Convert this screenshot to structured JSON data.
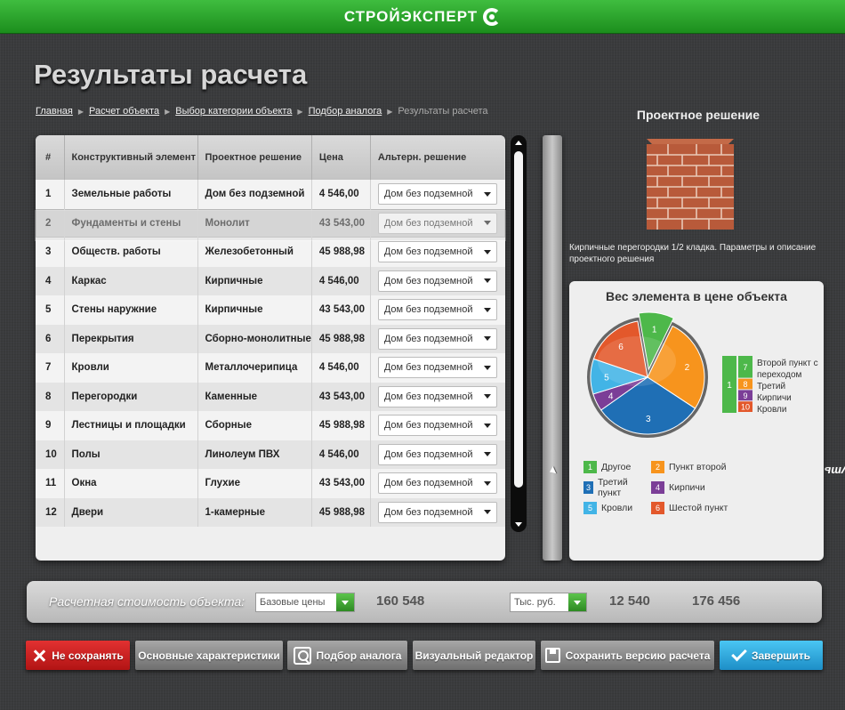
{
  "brand": {
    "name": "СТРОЙЭКСПЕРТ"
  },
  "page": {
    "title": "Результаты расчета"
  },
  "breadcrumbs": [
    "Главная",
    "Расчет объекта",
    "Выбор категории объекта",
    "Подбор аналога"
  ],
  "breadcrumb_current": "Результаты расчета",
  "table": {
    "headers": {
      "num": "#",
      "element": "Конструктивный элемент",
      "project": "Проектное решение",
      "price": "Цена",
      "alt": "Альтерн. решение"
    },
    "rows": [
      {
        "num": "1",
        "element": "Земельные работы",
        "project": "Дом без подземной",
        "price": "4 546,00",
        "alt": "Дом без подземной"
      },
      {
        "num": "2",
        "element": "Фундаменты и стены",
        "project": "Монолит",
        "price": "43 543,00",
        "alt": "Дом без подземной"
      },
      {
        "num": "3",
        "element": "Обществ. работы",
        "project": "Железобетонный",
        "price": "45 988,98",
        "alt": "Дом без подземной"
      },
      {
        "num": "4",
        "element": "Каркас",
        "project": "Кирпичные",
        "price": "4 546,00",
        "alt": "Дом без подземной"
      },
      {
        "num": "5",
        "element": "Стены наружние",
        "project": "Кирпичные",
        "price": "43 543,00",
        "alt": "Дом без подземной"
      },
      {
        "num": "6",
        "element": "Перекрытия",
        "project": "Сборно-монолитные",
        "price": "45 988,98",
        "alt": "Дом без подземной"
      },
      {
        "num": "7",
        "element": "Кровли",
        "project": "Металлочерипица",
        "price": "4 546,00",
        "alt": "Дом без подземной"
      },
      {
        "num": "8",
        "element": "Перегородки",
        "project": "Каменные",
        "price": "43 543,00",
        "alt": "Дом без подземной"
      },
      {
        "num": "9",
        "element": "Лестницы и площадки",
        "project": "Сборные",
        "price": "45 988,98",
        "alt": "Дом без подземной"
      },
      {
        "num": "10",
        "element": "Полы",
        "project": "Линолеум ПВХ",
        "price": "4 546,00",
        "alt": "Дом без подземной"
      },
      {
        "num": "11",
        "element": "Окна",
        "project": "Глухие",
        "price": "43 543,00",
        "alt": "Дом без подземной"
      },
      {
        "num": "12",
        "element": "Двери",
        "project": "1-камерные",
        "price": "45 988,98",
        "alt": "Дом без подземной"
      }
    ]
  },
  "collapse": {
    "label": "Свернуть"
  },
  "project_solution": {
    "title": "Проектное решение",
    "description": "Кирпичные перегородки 1/2 кладка. Параметры и описание проектного решения"
  },
  "chart_data": {
    "type": "pie",
    "title": "Вес элемента в цене объекта",
    "slices": [
      {
        "label": "1",
        "name": "Другое",
        "value": 10,
        "color": "#4db84a",
        "exploded": true
      },
      {
        "label": "2",
        "name": "Пункт второй",
        "value": 27,
        "color": "#f7941d"
      },
      {
        "label": "3",
        "name": "Третий пункт",
        "value": 31,
        "color": "#1f6fb5"
      },
      {
        "label": "4",
        "name": "Кирпичи",
        "value": 5,
        "color": "#7b3e97"
      },
      {
        "label": "5",
        "name": "Кровли",
        "value": 10,
        "color": "#42b4e6"
      },
      {
        "label": "6",
        "name": "Шестой пункт",
        "value": 17,
        "color": "#e3582b"
      }
    ],
    "sub_breakdown": [
      {
        "label": "7",
        "name": "Второй пункт с переходом",
        "value": 40,
        "color": "#4db84a"
      },
      {
        "label": "8",
        "name": "Третий",
        "value": 20,
        "color": "#f7941d"
      },
      {
        "label": "9",
        "name": "Кирпичи",
        "value": 20,
        "color": "#7b3e97"
      },
      {
        "label": "10",
        "name": "Кровли",
        "value": 20,
        "color": "#e3582b"
      }
    ],
    "sub_parent_label": "1",
    "legend_position": "bottom"
  },
  "summary": {
    "label": "Расчетная стоимость объекта:",
    "price_type": "Базовые цены",
    "value1": "160 548",
    "unit": "Тыс. руб.",
    "value2": "12 540",
    "value3": "176 456"
  },
  "buttons": {
    "no_save": "Не сохранять",
    "main_chars": "Основные характеристики",
    "analog": "Подбор аналога",
    "visual_editor": "Визуальный редактор",
    "save_version": "Сохранить версию расчета",
    "finish": "Завершить"
  }
}
